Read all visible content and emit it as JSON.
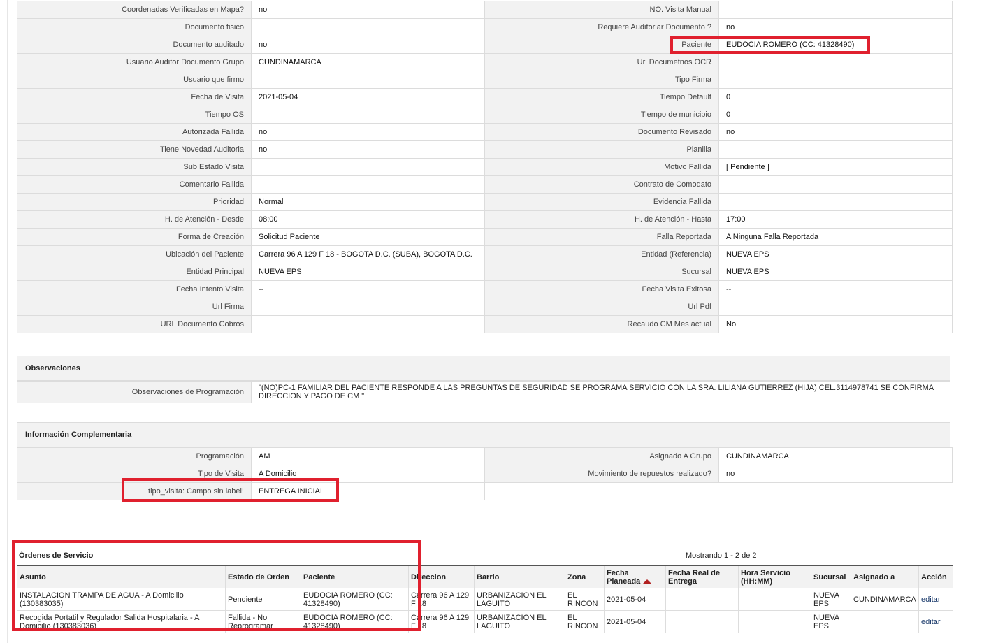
{
  "details_left": [
    {
      "label": "Coordenadas Verificadas en Mapa?",
      "value": "no"
    },
    {
      "label": "Documento fisico",
      "value": ""
    },
    {
      "label": "Documento auditado",
      "value": "no"
    },
    {
      "label": "Usuario Auditor Documento Grupo",
      "value": "CUNDINAMARCA"
    },
    {
      "label": "Usuario que firmo",
      "value": ""
    },
    {
      "label": "Fecha de Visita",
      "value": "2021-05-04"
    },
    {
      "label": "Tiempo OS",
      "value": ""
    },
    {
      "label": "Autorizada Fallida",
      "value": "no"
    },
    {
      "label": "Tiene Novedad Auditoria",
      "value": "no"
    },
    {
      "label": "Sub Estado Visita",
      "value": ""
    },
    {
      "label": "Comentario Fallida",
      "value": ""
    },
    {
      "label": "Prioridad",
      "value": "Normal"
    },
    {
      "label": "H. de Atención - Desde",
      "value": "08:00"
    },
    {
      "label": "Forma de Creación",
      "value": "Solicitud Paciente"
    },
    {
      "label": "Ubicación del Paciente",
      "value": "Carrera 96 A 129 F 18 - BOGOTA D.C. (SUBA), BOGOTA D.C."
    },
    {
      "label": "Entidad Principal",
      "value": "NUEVA EPS"
    },
    {
      "label": "Fecha Intento Visita",
      "value": "--"
    },
    {
      "label": "Url Firma",
      "value": ""
    },
    {
      "label": "URL Documento Cobros",
      "value": ""
    }
  ],
  "details_right": [
    {
      "label": "NO. Visita Manual",
      "value": ""
    },
    {
      "label": "Requiere Auditoriar Documento ?",
      "value": "no"
    },
    {
      "label": "Paciente",
      "value": "EUDOCIA ROMERO (CC: 41328490)"
    },
    {
      "label": "Url Documetnos OCR",
      "value": ""
    },
    {
      "label": "Tipo Firma",
      "value": ""
    },
    {
      "label": "Tiempo Default",
      "value": "0"
    },
    {
      "label": "Tiempo de municipio",
      "value": "0"
    },
    {
      "label": "Documento Revisado",
      "value": "no"
    },
    {
      "label": "Planilla",
      "value": ""
    },
    {
      "label": "Motivo Fallida",
      "value": "[ Pendiente ]"
    },
    {
      "label": "Contrato de Comodato",
      "value": ""
    },
    {
      "label": "Evidencia Fallida",
      "value": ""
    },
    {
      "label": "H. de Atención - Hasta",
      "value": "17:00"
    },
    {
      "label": "Falla Reportada",
      "value": "A Ninguna Falla Reportada"
    },
    {
      "label": "Entidad (Referencia)",
      "value": "NUEVA EPS"
    },
    {
      "label": "Sucursal",
      "value": "NUEVA EPS"
    },
    {
      "label": "Fecha Visita Exitosa",
      "value": "--"
    },
    {
      "label": "Url Pdf",
      "value": ""
    },
    {
      "label": "Recaudo CM Mes actual",
      "value": "No"
    }
  ],
  "observaciones": {
    "title": "Observaciones",
    "label": "Observaciones de Programación",
    "value": "\"(NO)PC-1 FAMILIAR DEL PACIENTE RESPONDE A LAS PREGUNTAS DE SEGURIDAD SE PROGRAMA SERVICIO CON LA SRA. LILIANA GUTIERREZ (HIJA) CEL.3114978741 SE CONFIRMA DIRECCION Y PAGO DE CM \""
  },
  "complementaria": {
    "title": "Información Complementaria",
    "rows": [
      {
        "l1": "Programación",
        "v1": "AM",
        "l2": "Asignado A Grupo",
        "v2": "CUNDINAMARCA"
      },
      {
        "l1": "Tipo de Visita",
        "v1": "A Domicilio",
        "l2": "Movimiento de repuestos realizado?",
        "v2": "no"
      },
      {
        "l1": "tipo_visita: Campo sin label!",
        "v1": "ENTREGA INICIAL"
      }
    ]
  },
  "orders": {
    "title": "Órdenes de Servicio",
    "showing": "Mostrando 1 - 2 de 2",
    "columns": [
      "Asunto",
      "Estado de Orden",
      "Paciente",
      "Direccion",
      "Barrio",
      "Zona",
      "Fecha Planeada",
      "Fecha Real de Entrega",
      "Hora Servicio (HH:MM)",
      "Sucursal",
      "Asignado a",
      "Acción"
    ],
    "rows": [
      {
        "asunto": "INSTALACION TRAMPA DE AGUA - A Domicilio (130383035)",
        "estado": "Pendiente",
        "paciente": "EUDOCIA ROMERO (CC: 41328490)",
        "direccion": "Carrera 96 A 129 F 18",
        "barrio": "URBANIZACION EL LAGUITO",
        "zona": "EL RINCON",
        "fecha_planeada": "2021-05-04",
        "fecha_real": "",
        "hora": "",
        "sucursal": "NUEVA EPS",
        "asignado": "CUNDINAMARCA",
        "accion": "editar"
      },
      {
        "asunto": "Recogida Portatil y Regulador Salida Hospitalaria - A Domicilio (130383036)",
        "estado": "Fallida - No Reprogramar",
        "paciente": "EUDOCIA ROMERO (CC: 41328490)",
        "direccion": "Carrera 96 A 129 F 18",
        "barrio": "URBANIZACION EL LAGUITO",
        "zona": "EL RINCON",
        "fecha_planeada": "2021-05-04",
        "fecha_real": "",
        "hora": "",
        "sucursal": "NUEVA EPS",
        "asignado": "",
        "accion": "editar"
      }
    ]
  },
  "colors": {
    "highlight": "#e0202e",
    "label_bg": "#f2f2f2",
    "sort_arrow": "#b22222"
  },
  "icons": {
    "sort": "sort-ascending-icon"
  }
}
